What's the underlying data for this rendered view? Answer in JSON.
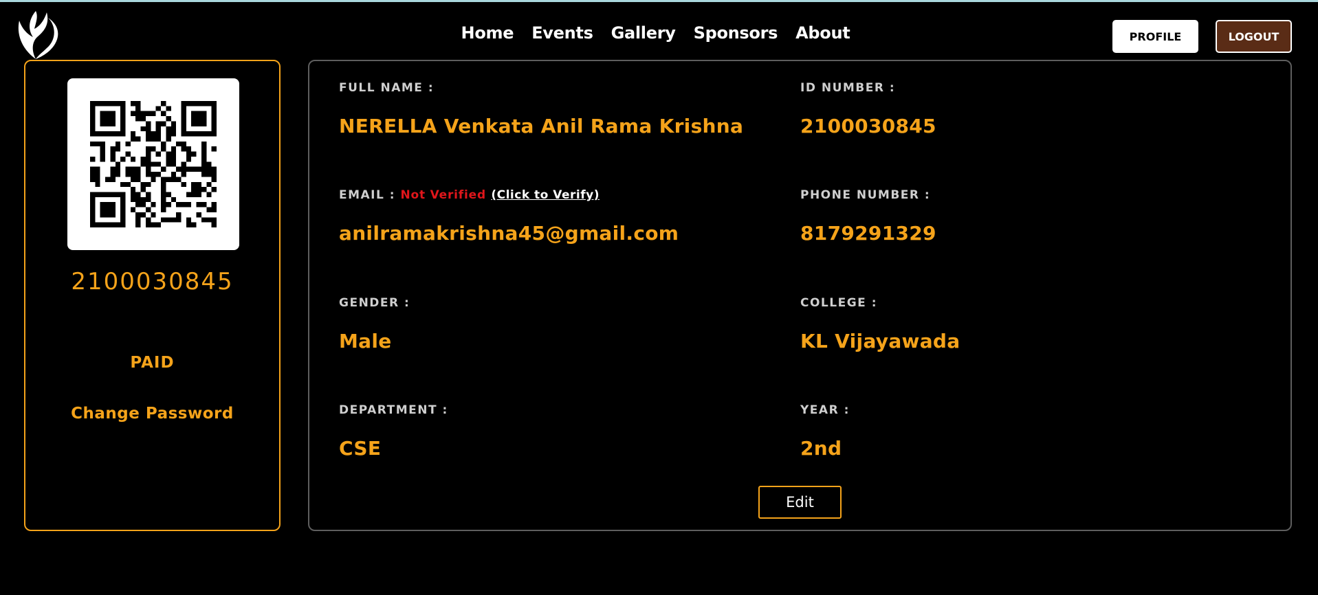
{
  "nav": {
    "items": [
      "Home",
      "Events",
      "Gallery",
      "Sponsors",
      "About"
    ],
    "profile_label": "PROFILE",
    "logout_label": "LOGOUT"
  },
  "sidebar": {
    "id_number": "2100030845",
    "payment_status": "PAID",
    "change_password_label": "Change Password"
  },
  "profile": {
    "full_name_label": "FULL NAME :",
    "full_name": "NERELLA Venkata Anil Rama Krishna",
    "id_number_label": "ID NUMBER :",
    "id_number": "2100030845",
    "email_label": "EMAIL :",
    "email_status": "Not Verified",
    "email_verify_link": "(Click to Verify)",
    "email": "anilramakrishna45@gmail.com",
    "phone_label": "PHONE NUMBER :",
    "phone": "8179291329",
    "gender_label": "GENDER :",
    "gender": "Male",
    "college_label": "COLLEGE :",
    "college": "KL Vijayawada",
    "department_label": "DEPARTMENT :",
    "department": "CSE",
    "year_label": "YEAR :",
    "year": "2nd",
    "edit_label": "Edit"
  },
  "colors": {
    "accent": "#f5a31a",
    "danger": "#e0161b",
    "logout_bg": "#5a2c16"
  }
}
